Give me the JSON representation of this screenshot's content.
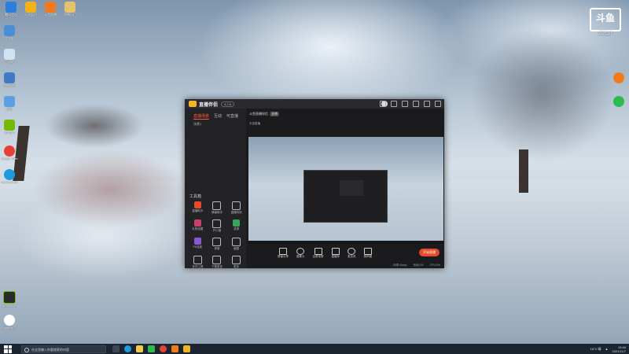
{
  "desktop": {
    "icons_left_top": [
      "腾讯会议",
      "无畏契约",
      "斗鱼直播",
      "直播伴侣"
    ],
    "icons_left": [
      "此电脑",
      "回收站",
      "控制面板",
      "网络",
      "NVIDIA",
      "Google Chrome",
      "Microsoft Edge"
    ],
    "icons_left_bottom": [
      "GeForce Experience",
      "Logitech G HUB"
    ]
  },
  "brand": {
    "mark": "斗鱼",
    "date": "20211/7"
  },
  "app": {
    "title": "直播伴侣",
    "version": "4.2.6",
    "sidebar_tabs": [
      "直播场景",
      "互动",
      "可直播"
    ],
    "scene_label": "场景1",
    "tools_header": "工具箱",
    "tools": [
      "直播助手",
      "弹幕助手",
      "直播特效",
      "礼物设置",
      "开小窗",
      "录屏",
      "PK连麦",
      "房管",
      "截图",
      "多开工具",
      "下载更多",
      "更多"
    ],
    "notice": "疑似您有与直播有关的问题吗?",
    "main_title": "斗鱼直播伴侣",
    "main_badge": "直播",
    "room_tag": "手游直播",
    "controls": [
      "屏幕分享",
      "摄像头",
      "全屏录屏",
      "直播伴",
      "麦克风",
      "扬声器"
    ],
    "go_live": "开始直播",
    "status_items": [
      "码率:0kbps",
      "丢帧:0%",
      "CPU:0%"
    ]
  },
  "taskbar": {
    "search_placeholder": "在这里输入你要搜索的内容",
    "weather": "16°C 晴",
    "time": "19:40",
    "date": "2021/11/7"
  },
  "colors": {
    "accent": "#e64a2b",
    "window_bg": "#1f1f22"
  }
}
